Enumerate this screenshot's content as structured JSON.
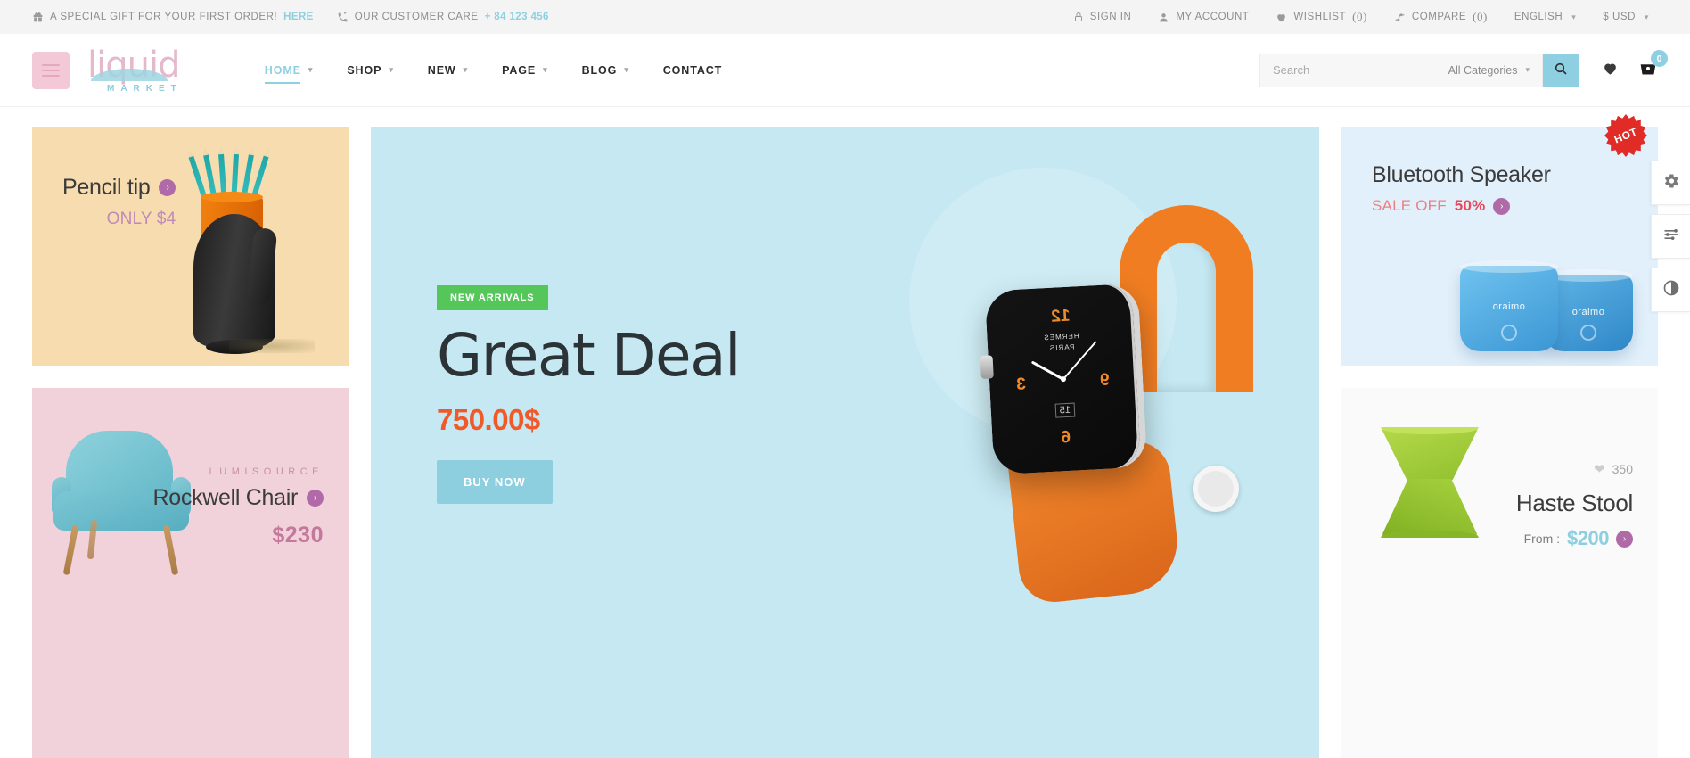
{
  "topbar": {
    "gift_text": "A SPECIAL GIFT FOR YOUR FIRST ORDER!",
    "gift_link": "HERE",
    "care_text": "OUR CUSTOMER CARE",
    "care_phone": "+ 84 123 456",
    "sign_in": "SIGN IN",
    "my_account": "MY ACCOUNT",
    "wishlist": "WISHLIST",
    "wishlist_count": "(0)",
    "compare": "COMPARE",
    "compare_count": "(0)",
    "language": "ENGLISH",
    "currency": "$ USD"
  },
  "header": {
    "logo_main": "liquid",
    "logo_sub": "MARKET",
    "nav": [
      {
        "label": "HOME",
        "has_caret": true,
        "active": true
      },
      {
        "label": "SHOP",
        "has_caret": true,
        "active": false
      },
      {
        "label": "NEW",
        "has_caret": true,
        "active": false
      },
      {
        "label": "PAGE",
        "has_caret": true,
        "active": false
      },
      {
        "label": "BLOG",
        "has_caret": true,
        "active": false
      },
      {
        "label": "CONTACT",
        "has_caret": false,
        "active": false
      }
    ],
    "search_placeholder": "Search",
    "search_value": "",
    "category_selected": "All Categories",
    "cart_count": "0"
  },
  "banners": {
    "pencil": {
      "title": "Pencil tip",
      "subtitle": "ONLY $4",
      "bg": "#f7dcaf"
    },
    "chair": {
      "eyebrow": "LUMISOURCE",
      "title": "Rockwell Chair",
      "price": "$230",
      "bg": "#f2d2da"
    },
    "hero": {
      "badge": "NEW ARRIVALS",
      "title": "Great Deal",
      "price": "750.00$",
      "cta": "BUY NOW",
      "bg": "#c5e8f2",
      "watch_brand": "HERMES\nPARIS",
      "watch_n12": "12",
      "watch_n3": "3",
      "watch_n9": "9",
      "watch_n6": "6",
      "watch_date": "15"
    },
    "speaker": {
      "title": "Bluetooth Speaker",
      "sale_label": "SALE OFF",
      "sale_value": "50%",
      "brand": "oraimo",
      "bg": "#e2f0fb"
    },
    "stool": {
      "likes": "350",
      "title": "Haste Stool",
      "from_label": "From :",
      "price": "$200",
      "bg": "#fafafa"
    }
  },
  "badges": {
    "hot": "HOT"
  },
  "colors": {
    "accent_teal": "#8ed0e2",
    "accent_pink": "#c4799c",
    "accent_orange": "#f05a2b",
    "accent_green": "#55c75a",
    "accent_red": "#e02b26",
    "accent_purple": "#b06aa8"
  }
}
